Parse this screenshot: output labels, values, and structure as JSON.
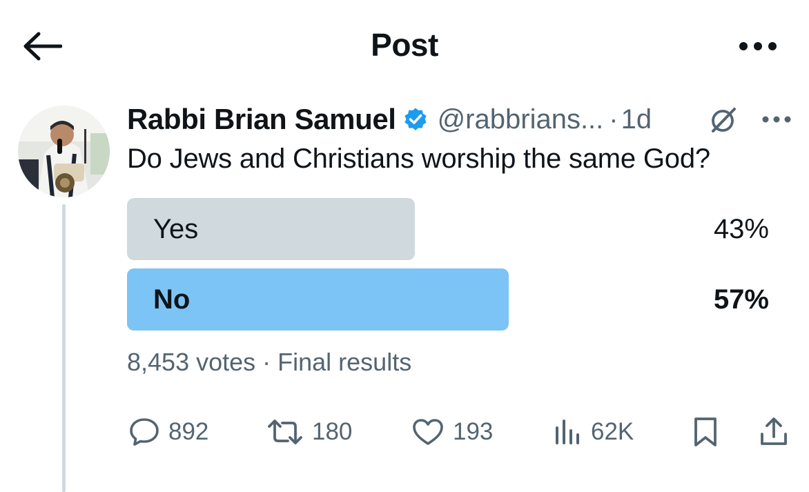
{
  "header": {
    "title": "Post",
    "back_icon": "arrow-left-icon",
    "more_icon": "more-horizontal-icon"
  },
  "post": {
    "author_name": "Rabbi Brian Samuel",
    "handle": "@rabbrians...",
    "separator": "·",
    "time": "1d",
    "verified_color": "#1d9bf0",
    "text": "Do Jews and Christians worship the same God?",
    "grok_icon": "grok-slash-icon",
    "more_icon": "more-horizontal-icon"
  },
  "poll": {
    "options": [
      {
        "label": "Yes",
        "percent_text": "43%",
        "percent": 43,
        "color": "#cfd9de",
        "winner": false
      },
      {
        "label": "No",
        "percent_text": "57%",
        "percent": 57,
        "color": "#7cc4f5",
        "winner": true
      }
    ],
    "footer": "8,453 votes · Final results"
  },
  "actions": {
    "reply": {
      "icon": "reply-bubble-icon",
      "count": "892"
    },
    "repost": {
      "icon": "repost-icon",
      "count": "180"
    },
    "like": {
      "icon": "heart-icon",
      "count": "193"
    },
    "views": {
      "icon": "views-chart-icon",
      "count": "62K"
    },
    "bookmark": {
      "icon": "bookmark-icon"
    },
    "share": {
      "icon": "share-icon"
    }
  }
}
